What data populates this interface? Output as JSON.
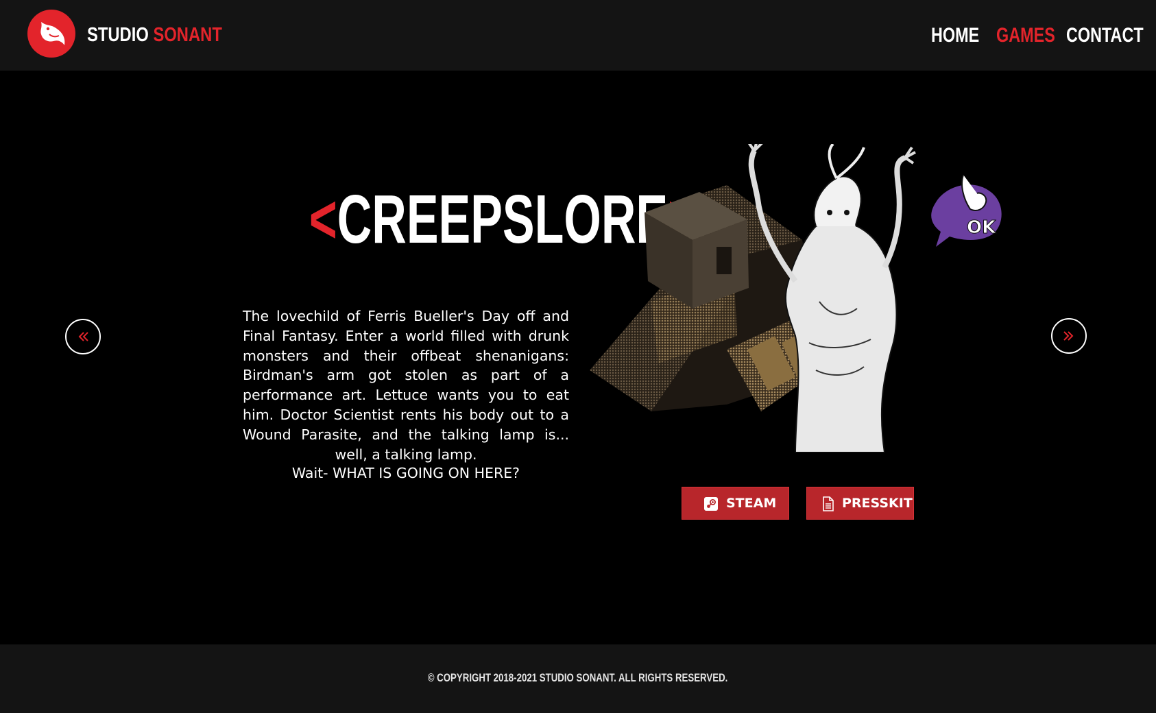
{
  "header": {
    "brand_first": "STUDIO",
    "brand_second": "SONANT",
    "logo_icon": "bird-icon",
    "nav": [
      {
        "label": "HOME",
        "active": false
      },
      {
        "label": "GAMES",
        "active": true
      },
      {
        "label": "CONTACT",
        "active": false
      }
    ]
  },
  "carousel": {
    "prev_icon": "double-chevron-left-icon",
    "next_icon": "double-chevron-right-icon",
    "title_open": "<",
    "title": "CREEPSLORE",
    "title_close": ">",
    "description": "The lovechild of Ferris Bueller's Day off and Final Fantasy. Enter a world filled with drunk monsters and their offbeat shenanigans: Birdman's arm got stolen as part of a performance art. Lettuce wants you to eat him. Doctor Scientist rents his body out to a Wound Parasite, and the talking lamp is... well, a talking lamp.",
    "tagline": "Wait- WHAT IS GOING ON HERE?",
    "art_badge": "OK",
    "buttons": {
      "steam_label": "STEAM",
      "steam_icon": "steam-icon",
      "presskit_label": "PRESSKIT",
      "presskit_icon": "document-icon"
    }
  },
  "footer": {
    "copyright": "© COPYRIGHT 2018-2021 STUDIO SONANT. ALL RIGHTS RESERVED."
  },
  "colors": {
    "accent": "#e3242b",
    "button_bg": "#b8262b",
    "header_bg": "#141414",
    "page_bg": "#000000",
    "badge_purple": "#6b3fa0"
  }
}
